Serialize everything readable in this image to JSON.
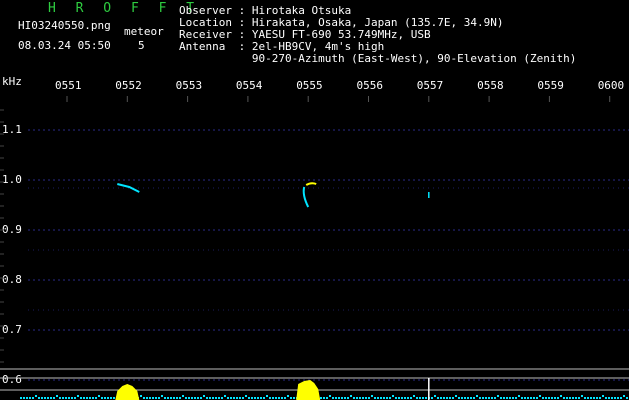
{
  "header": {
    "app_title": "H R O F F T",
    "filename": "HI03240550.png",
    "datetime": "08.03.24 05:50",
    "meteor_label": "meteor",
    "meteor_count": "5"
  },
  "info": {
    "observer": "Observer : Hirotaka Otsuka",
    "location": "Location : Hirakata, Osaka, Japan (135.7E, 34.9N)",
    "receiver": "Receiver : YAESU FT-690 53.749MHz, USB",
    "antenna": "Antenna  : 2el-HB9CV, 4m's high",
    "antenna_detail": "           90-270-Azimuth (East-West), 90-Elevation (Zenith)"
  },
  "chart_data": {
    "type": "spectrogram",
    "ylabel": "kHz",
    "x_ticks": [
      "0551",
      "0552",
      "0553",
      "0554",
      "0555",
      "0556",
      "0557",
      "0558",
      "0559",
      "0600"
    ],
    "y_ticks": [
      "1.1",
      "1.0",
      "0.9",
      "0.8",
      "0.7",
      "0.6"
    ],
    "ylim": [
      0.58,
      1.12
    ],
    "grid": true,
    "detected_meteors": [
      {
        "time": "05:52",
        "freq_khz": 0.99
      },
      {
        "time": "05:55",
        "freq_khz": 0.99
      },
      {
        "time": "05:57",
        "freq_khz": 0.97
      }
    ],
    "colors": {
      "title": "#2ecc40",
      "text": "#ffffff",
      "trace_cyan": "#00e5ff",
      "trace_yellow": "#ffff00",
      "grid": "#2a2a8a",
      "ref_lines": "#bbbbbb",
      "background": "#000000"
    }
  }
}
